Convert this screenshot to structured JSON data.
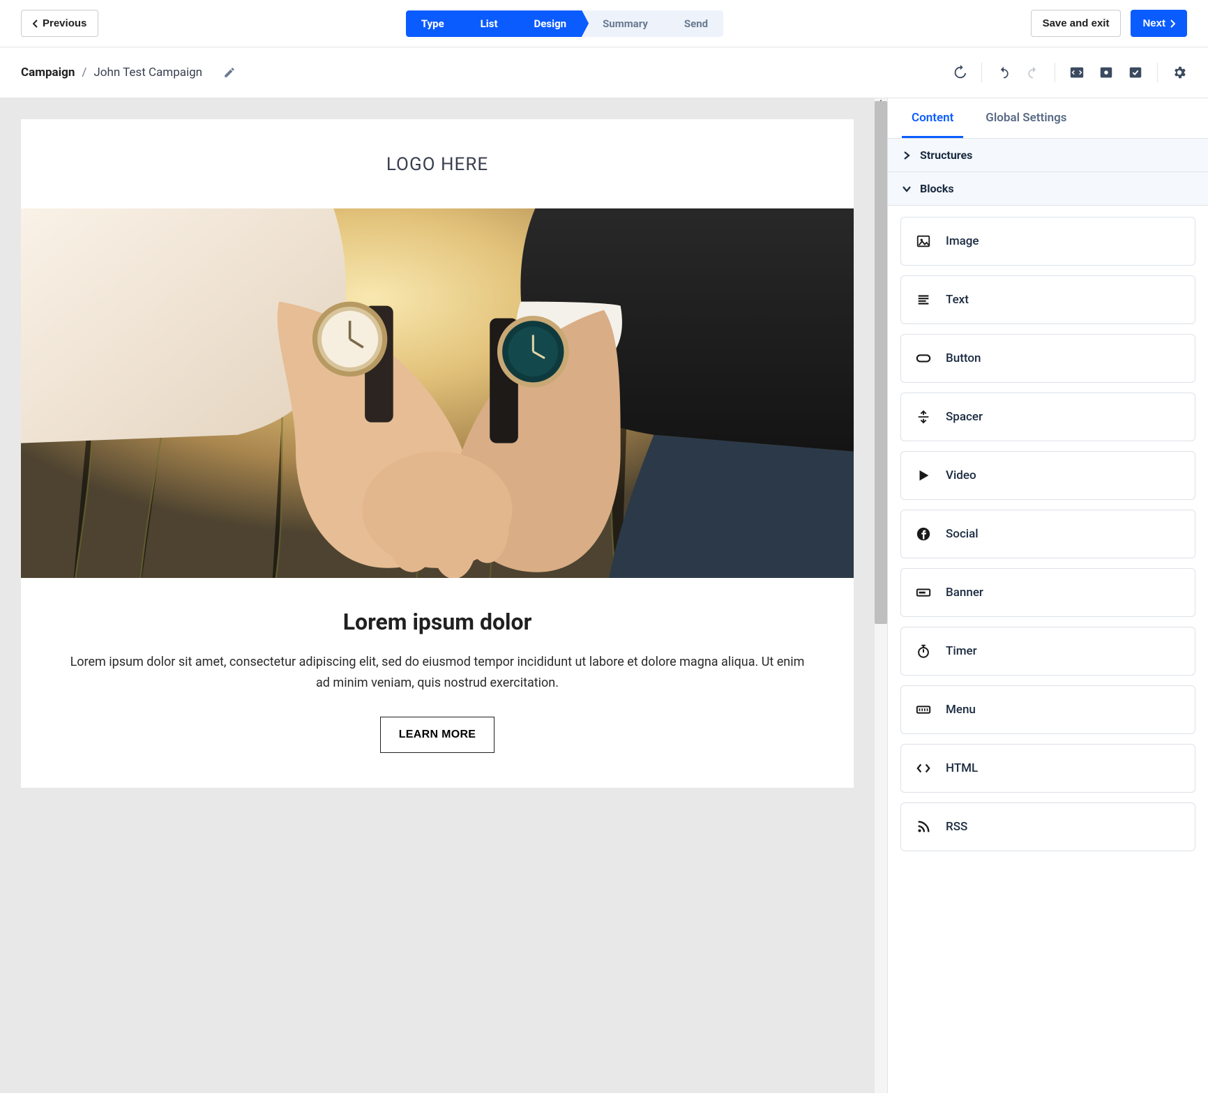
{
  "top": {
    "prev": "Previous",
    "save": "Save and exit",
    "next": "Next",
    "steps": [
      "Type",
      "List",
      "Design",
      "Summary",
      "Send"
    ],
    "active_step_index": 2
  },
  "breadcrumb": {
    "root": "Campaign",
    "name": "John Test Campaign"
  },
  "canvas": {
    "logo": "LOGO HERE",
    "title": "Lorem ipsum dolor",
    "body": "Lorem ipsum dolor sit amet, consectetur adipiscing elit, sed do eiusmod tempor incididunt ut labore et dolore magna aliqua. Ut enim ad minim veniam, quis nostrud exercitation.",
    "cta": "LEARN MORE"
  },
  "panel": {
    "tabs": {
      "content": "Content",
      "global": "Global Settings"
    },
    "sections": {
      "structures": "Structures",
      "blocks": "Blocks"
    },
    "blocks": [
      {
        "id": "image",
        "label": "Image"
      },
      {
        "id": "text",
        "label": "Text"
      },
      {
        "id": "button",
        "label": "Button"
      },
      {
        "id": "spacer",
        "label": "Spacer"
      },
      {
        "id": "video",
        "label": "Video"
      },
      {
        "id": "social",
        "label": "Social"
      },
      {
        "id": "banner",
        "label": "Banner"
      },
      {
        "id": "timer",
        "label": "Timer"
      },
      {
        "id": "menu",
        "label": "Menu"
      },
      {
        "id": "html",
        "label": "HTML"
      },
      {
        "id": "rss",
        "label": "RSS"
      }
    ]
  }
}
